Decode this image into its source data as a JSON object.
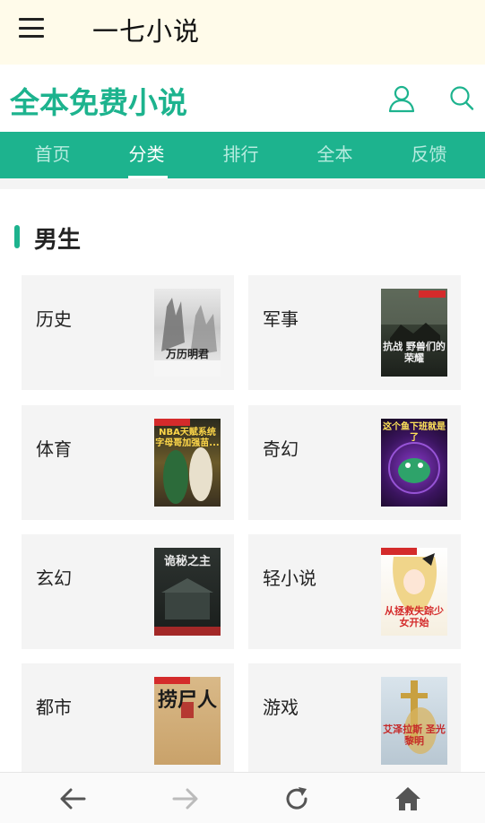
{
  "browser": {
    "title": "一七小说"
  },
  "site": {
    "logo": "全本免费小说",
    "accent": "#1db38e"
  },
  "nav": {
    "items": [
      {
        "label": "首页",
        "active": false
      },
      {
        "label": "分类",
        "active": true
      },
      {
        "label": "排行",
        "active": false
      },
      {
        "label": "全本",
        "active": false
      },
      {
        "label": "反馈",
        "active": false
      }
    ]
  },
  "section": {
    "title": "男生"
  },
  "categories": [
    {
      "label": "历史",
      "cover_text": "万历明君"
    },
    {
      "label": "军事",
      "cover_text": "抗战 野兽们的荣耀"
    },
    {
      "label": "体育",
      "cover_text": "NBA天赋系统 字母哥加强苗..."
    },
    {
      "label": "奇幻",
      "cover_text": "这个鱼下班就是了"
    },
    {
      "label": "玄幻",
      "cover_text": "诡秘之主"
    },
    {
      "label": "轻小说",
      "cover_text": "从拯救失踪少女开始"
    },
    {
      "label": "都市",
      "cover_text": "捞尸人"
    },
    {
      "label": "游戏",
      "cover_text": "艾泽拉斯 圣光黎明"
    }
  ],
  "icons": {
    "menu": "hamburger-icon",
    "user": "user-icon",
    "search": "search-icon",
    "back": "arrow-left-icon",
    "forward": "arrow-right-icon",
    "refresh": "refresh-icon",
    "home": "home-icon"
  }
}
